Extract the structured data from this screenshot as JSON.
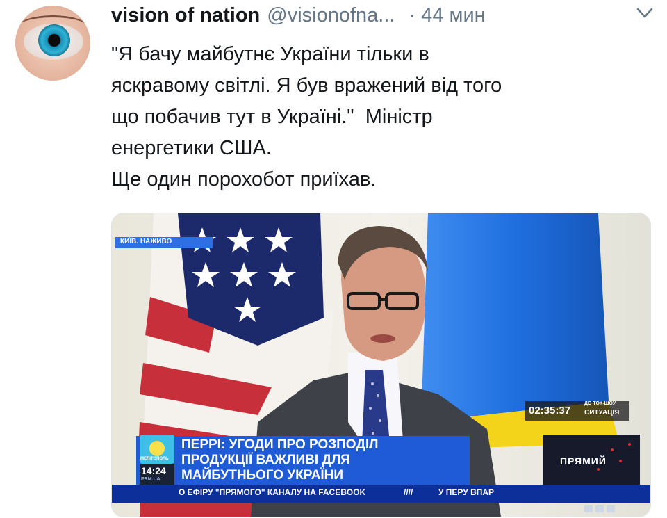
{
  "tweet": {
    "author_name": "vision of nation",
    "author_handle": "@visionofna...",
    "time": "· 44 мин",
    "text": "\"Я бачу майбутнє України тільки в\nяскравому світлі. Я був вражений від того\nщо побачив тут в Україні.\"  Міністр\nенергетики США.\nЩе один порохобот приїхав."
  },
  "icons": {
    "avatar": "eye-avatar-icon",
    "menu": "chevron-down-icon"
  },
  "video_overlay": {
    "location_badge": "КИЇВ. НАЖИВО",
    "timecode": "02:35:37",
    "show_caption_small": "ДО ТОК-ШОУ",
    "show_caption": "СИТУАЦІЯ",
    "headline_line1": "ПЕРРІ: УГОДИ ПРО РОЗПОДІЛ",
    "headline_line2": "ПРОДУКЦІЇ ВАЖЛИВІ ДЛЯ",
    "headline_line3": "МАЙБУТНЬОГО УКРАЇНИ",
    "clock": "14:24",
    "region": "МЕЛІТОПОЛЬ",
    "site": "PRM.UA",
    "ticker": "О ЕФІРУ \"ПРЯМОГО\" КАНАЛУ НА FACEBOOK",
    "ticker_marks": "////",
    "ticker2": "У ПЕРУ ВПАР",
    "channel_logo": "ПРЯМИЙ",
    "colors": {
      "headline_bg": "#1f5bd6",
      "ticker_bg": "#0c2f9a",
      "ua_blue": "#1f6fe0",
      "ua_yellow": "#f4d31b",
      "us_red": "#c7303a",
      "us_blue": "#1c2a6b"
    }
  }
}
